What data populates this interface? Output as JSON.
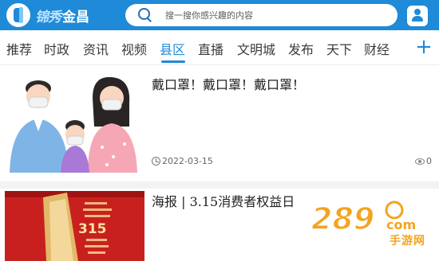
{
  "header": {
    "logo_script": "锦秀",
    "logo_text": "金昌",
    "search_placeholder": "搜一搜你感兴趣的内容",
    "search_icon": "search-icon",
    "user_icon": "user-icon"
  },
  "tabs": {
    "items": [
      {
        "label": "推荐",
        "active": false
      },
      {
        "label": "时政",
        "active": false
      },
      {
        "label": "资讯",
        "active": false
      },
      {
        "label": "视频",
        "active": false
      },
      {
        "label": "县区",
        "active": true
      },
      {
        "label": "直播",
        "active": false
      },
      {
        "label": "文明城",
        "active": false
      },
      {
        "label": "发布",
        "active": false
      },
      {
        "label": "天下",
        "active": false
      },
      {
        "label": "财经",
        "active": false
      }
    ],
    "add_label": "+"
  },
  "articles": [
    {
      "title": "戴口罩！戴口罩！戴口罩！",
      "date": "2022-03-15",
      "views": "0"
    },
    {
      "title": "海报 | 3.15消费者权益日",
      "poster_number": "315"
    }
  ],
  "watermark": {
    "number": "289",
    "suffix": "com",
    "label": "手游网"
  },
  "colors": {
    "accent": "#1f8ad7",
    "poster_red": "#c8201f",
    "watermark": "#f3a41f"
  }
}
